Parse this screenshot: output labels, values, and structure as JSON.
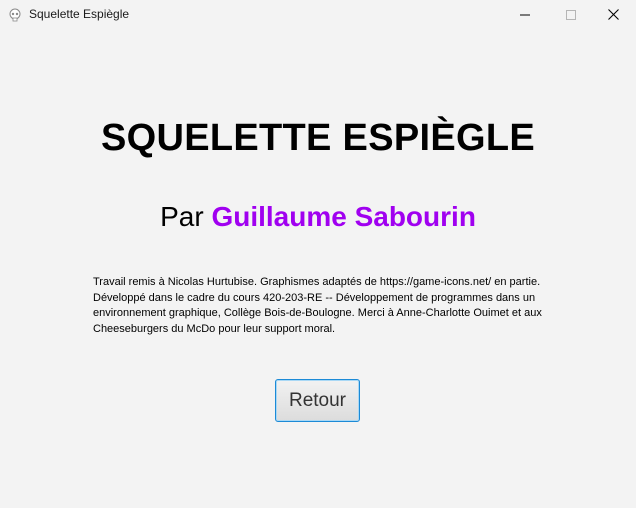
{
  "window": {
    "title": "Squelette Espiègle",
    "icon": "skull-icon",
    "controls": {
      "minimize_icon": "minimize-icon",
      "maximize_icon": "maximize-icon",
      "close_icon": "close-icon"
    }
  },
  "main": {
    "title": "SQUELETTE ESPIÈGLE",
    "author_prefix": "Par",
    "author_name": "Guillaume Sabourin",
    "credits": "Travail remis à Nicolas Hurtubise. Graphismes adaptés de https://game-icons.net/ en partie. Développé  dans le cadre du cours 420-203-RE -- Développement de programmes dans un environnement graphique, Collège Bois-de-Boulogne. Merci à Anne-Charlotte Ouimet et aux Cheeseburgers du McDo pour leur support moral.",
    "back_button_label": "Retour"
  },
  "colors": {
    "background": "#f3f3f3",
    "author_name": "#a000f0",
    "button_focus_border": "#1c8ad6"
  }
}
